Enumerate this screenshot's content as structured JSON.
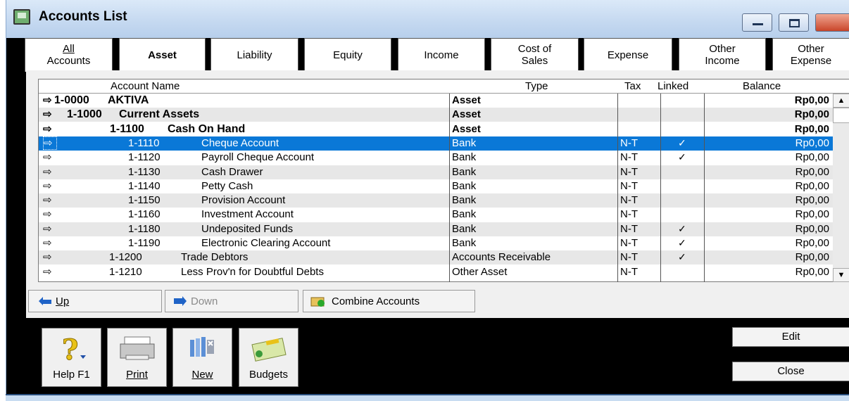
{
  "window": {
    "title": "Accounts List"
  },
  "tabs": [
    {
      "label": "All Accounts",
      "l1": "All",
      "l2": "Accounts"
    },
    {
      "label": "Asset"
    },
    {
      "label": "Liability"
    },
    {
      "label": "Equity"
    },
    {
      "label": "Income"
    },
    {
      "label": "Cost of Sales",
      "l1": "Cost of",
      "l2": "Sales"
    },
    {
      "label": "Expense"
    },
    {
      "label": "Other Income",
      "l1": "Other",
      "l2": "Income"
    },
    {
      "label": "Other Expense",
      "l1": "Other",
      "l2": "Expense"
    }
  ],
  "grid": {
    "headers": {
      "name": "Account Name",
      "type": "Type",
      "tax": "Tax",
      "linked": "Linked",
      "balance": "Balance"
    },
    "arrow_glyph": "⇨",
    "check_glyph": "✓",
    "rows": [
      {
        "number": "1-0000",
        "name": "AKTIVA",
        "type": "Asset",
        "tax": "",
        "linked": "",
        "balance": "Rp0,00",
        "level": 0,
        "header": true
      },
      {
        "number": "1-1000",
        "name": "Current Assets",
        "type": "Asset",
        "tax": "",
        "linked": "",
        "balance": "Rp0,00",
        "level": 1,
        "header": true
      },
      {
        "number": "1-1100",
        "name": "Cash On Hand",
        "type": "Asset",
        "tax": "",
        "linked": "",
        "balance": "Rp0,00",
        "level": 2,
        "header": true
      },
      {
        "number": "1-1110",
        "name": "Cheque Account",
        "type": "Bank",
        "tax": "N-T",
        "linked": "✓",
        "balance": "Rp0,00",
        "level": 3,
        "selected": true
      },
      {
        "number": "1-1120",
        "name": "Payroll Cheque Account",
        "type": "Bank",
        "tax": "N-T",
        "linked": "✓",
        "balance": "Rp0,00",
        "level": 3
      },
      {
        "number": "1-1130",
        "name": "Cash Drawer",
        "type": "Bank",
        "tax": "N-T",
        "linked": "",
        "balance": "Rp0,00",
        "level": 3
      },
      {
        "number": "1-1140",
        "name": "Petty Cash",
        "type": "Bank",
        "tax": "N-T",
        "linked": "",
        "balance": "Rp0,00",
        "level": 3
      },
      {
        "number": "1-1150",
        "name": "Provision Account",
        "type": "Bank",
        "tax": "N-T",
        "linked": "",
        "balance": "Rp0,00",
        "level": 3
      },
      {
        "number": "1-1160",
        "name": "Investment Account",
        "type": "Bank",
        "tax": "N-T",
        "linked": "",
        "balance": "Rp0,00",
        "level": 3
      },
      {
        "number": "1-1180",
        "name": "Undeposited Funds",
        "type": "Bank",
        "tax": "N-T",
        "linked": "✓",
        "balance": "Rp0,00",
        "level": 3
      },
      {
        "number": "1-1190",
        "name": "Electronic Clearing Account",
        "type": "Bank",
        "tax": "N-T",
        "linked": "✓",
        "balance": "Rp0,00",
        "level": 3
      },
      {
        "number": "1-1200",
        "name": "Trade Debtors",
        "type": "Accounts Receivable",
        "tax": "N-T",
        "linked": "✓",
        "balance": "Rp0,00",
        "level": 2
      },
      {
        "number": "1-1210",
        "name": "Less Prov'n for Doubtful Debts",
        "type": "Other Asset",
        "tax": "N-T",
        "linked": "",
        "balance": "Rp0,00",
        "level": 2
      }
    ]
  },
  "panel_buttons": {
    "up": "Up",
    "down": "Down",
    "combine": "Combine Accounts"
  },
  "toolbar": {
    "help": "Help F1",
    "print": "Print",
    "new": "New",
    "budgets": "Budgets"
  },
  "actions": {
    "edit": "Edit",
    "close": "Close"
  },
  "colors": {
    "selection": "#0a78d7",
    "titlebar": "#c4d8f0",
    "window_bg": "#000000"
  }
}
